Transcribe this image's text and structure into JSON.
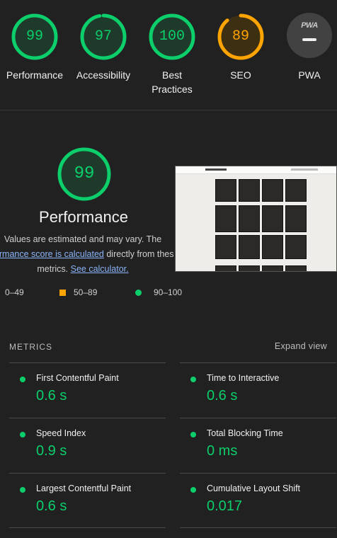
{
  "gauges": [
    {
      "label": "Performance",
      "score": "99",
      "score_value": 99,
      "color": "#0cce6b"
    },
    {
      "label": "Accessibility",
      "score": "97",
      "score_value": 97,
      "color": "#0cce6b"
    },
    {
      "label": "Best Practices",
      "score": "100",
      "score_value": 100,
      "color": "#0cce6b"
    },
    {
      "label": "SEO",
      "score": "89",
      "score_value": 89,
      "color": "#ffa400"
    },
    {
      "label": "PWA",
      "badge": "PWA"
    }
  ],
  "performance": {
    "score": "99",
    "score_value": 99,
    "title": "Performance",
    "desc_line1": "Values are estimated and may vary. The",
    "desc_link1": "formance score is calculated",
    "desc_line2_rest": " directly from thes",
    "desc_line3_pre": "metrics. ",
    "desc_link2": "See calculator."
  },
  "legend": {
    "fail": "0–49",
    "average": "50–89",
    "pass": "90–100"
  },
  "metrics_section": {
    "title": "METRICS",
    "expand_label": "Expand view"
  },
  "metrics": [
    {
      "name": "First Contentful Paint",
      "value": "0.6 s"
    },
    {
      "name": "Time to Interactive",
      "value": "0.6 s"
    },
    {
      "name": "Speed Index",
      "value": "0.9 s"
    },
    {
      "name": "Total Blocking Time",
      "value": "0 ms"
    },
    {
      "name": "Largest Contentful Paint",
      "value": "0.6 s"
    },
    {
      "name": "Cumulative Layout Shift",
      "value": "0.017"
    }
  ],
  "colors": {
    "pass": "#0cce6b",
    "average": "#ffa400",
    "background": "#212121"
  }
}
